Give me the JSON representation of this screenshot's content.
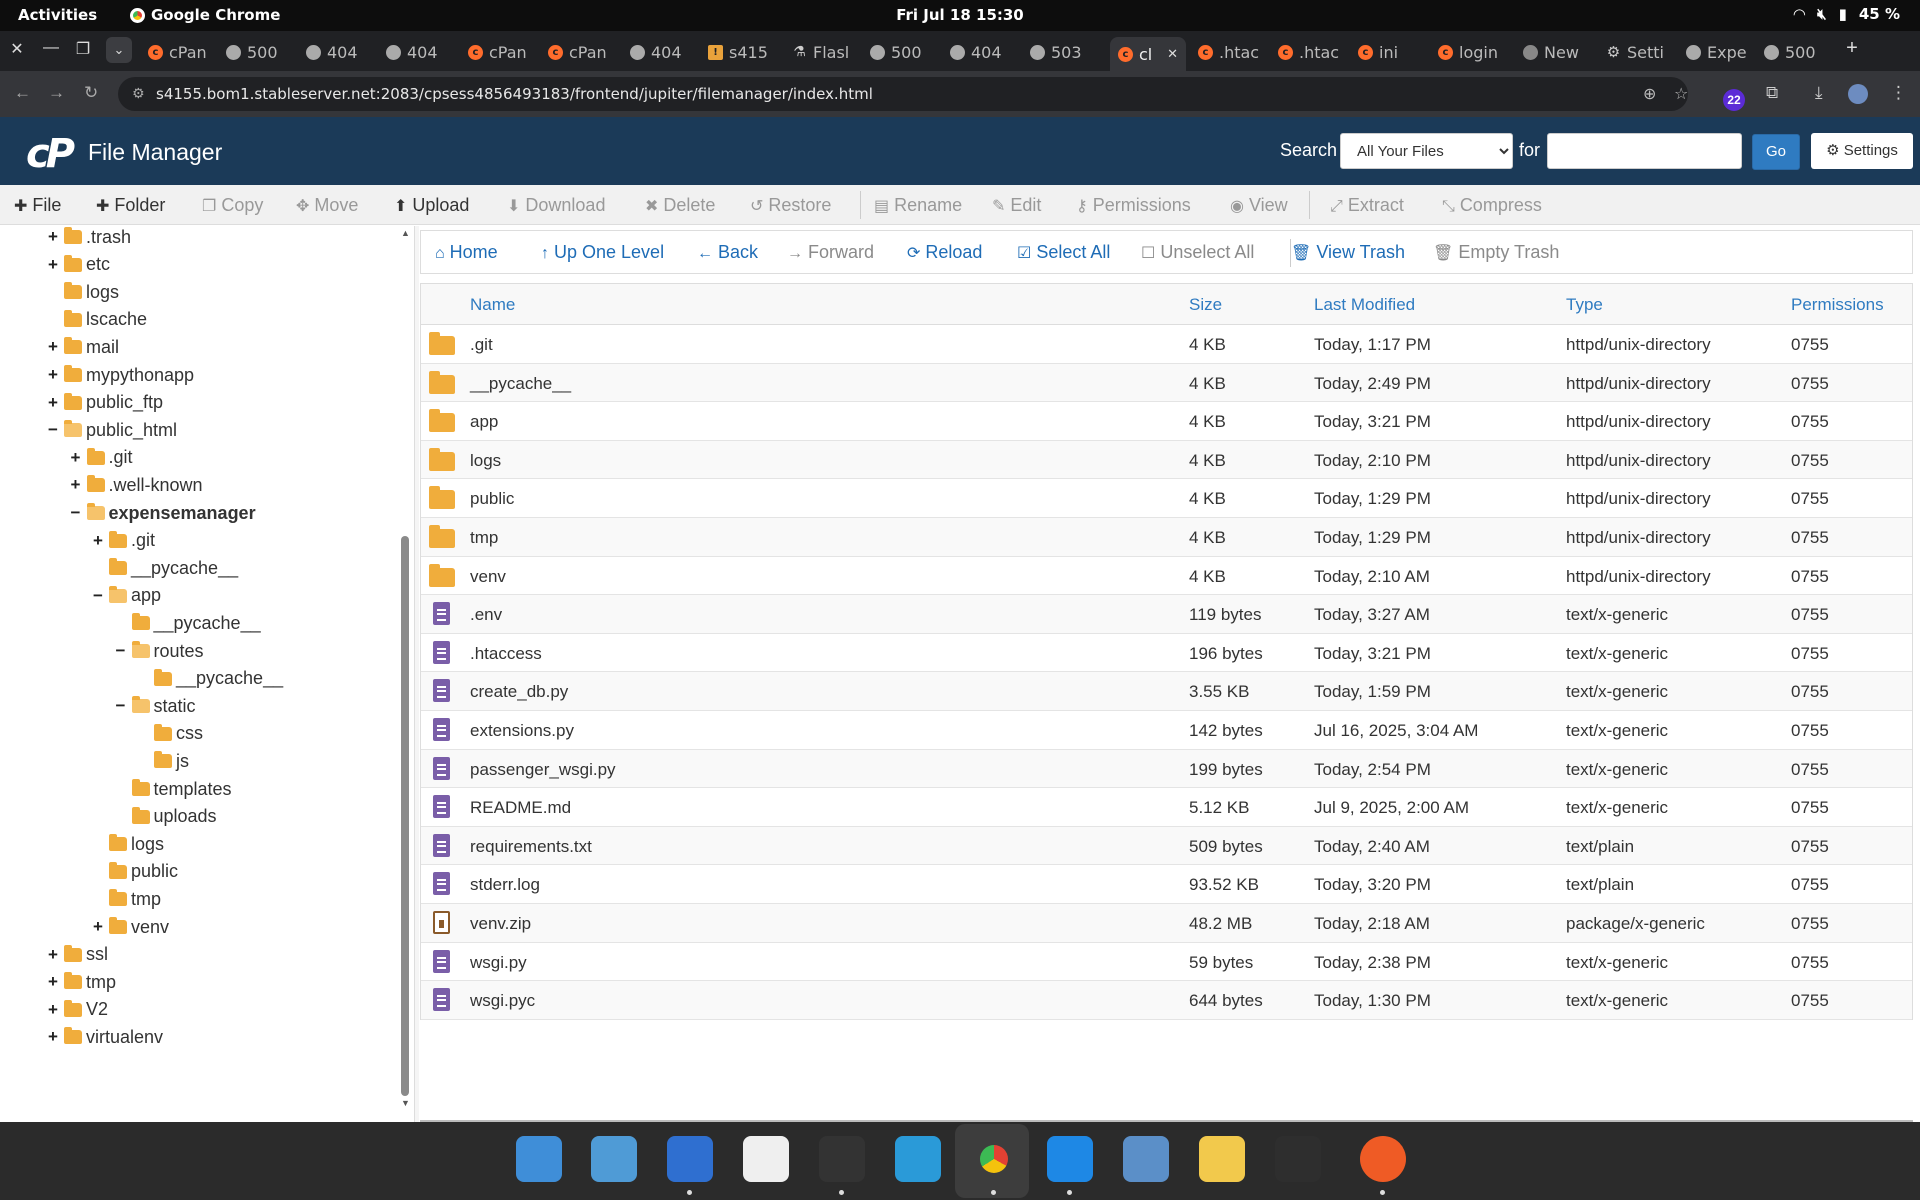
{
  "system": {
    "activities": "Activities",
    "app_name": "Google Chrome",
    "clock": "Fri Jul 18  15:30",
    "battery": "45 %"
  },
  "tabs": [
    {
      "label": "cPan",
      "icon": "cpanel-icon"
    },
    {
      "label": "500",
      "icon": "globe-icon"
    },
    {
      "label": "404",
      "icon": "globe-icon"
    },
    {
      "label": "404",
      "icon": "globe-icon"
    },
    {
      "label": "cPan",
      "icon": "cpanel-icon"
    },
    {
      "label": "cPan",
      "icon": "cpanel-icon"
    },
    {
      "label": "404",
      "icon": "globe-icon"
    },
    {
      "label": "s415",
      "icon": "warning-icon"
    },
    {
      "label": "Flasl",
      "icon": "flask-icon"
    },
    {
      "label": "500",
      "icon": "globe-icon"
    },
    {
      "label": "404",
      "icon": "globe-icon"
    },
    {
      "label": "503",
      "icon": "globe-icon"
    },
    {
      "label": "cl",
      "icon": "cpanel-icon",
      "active": true
    },
    {
      "label": ".htac",
      "icon": "cpanel-icon"
    },
    {
      "label": ".htac",
      "icon": "cpanel-icon"
    },
    {
      "label": "ini",
      "icon": "cpanel-icon"
    },
    {
      "label": "login",
      "icon": "cpanel-icon"
    },
    {
      "label": "New",
      "icon": "chrome-icon"
    },
    {
      "label": "Setti",
      "icon": "gear-icon"
    },
    {
      "label": "Expe",
      "icon": "globe-icon"
    },
    {
      "label": "500",
      "icon": "globe-icon"
    }
  ],
  "address": {
    "url": "s4155.bom1.stableserver.net:2083/cpsess4856493183/frontend/jupiter/filemanager/index.html",
    "extension_badge": "22"
  },
  "header": {
    "logo": "cP",
    "title": "File Manager",
    "search_label": "Search",
    "search_scope": "All Your Files",
    "for_label": "for",
    "search_value": "",
    "go_label": "Go",
    "settings_label": "Settings"
  },
  "toolbar": {
    "file": "File",
    "folder": "Folder",
    "copy": "Copy",
    "move": "Move",
    "upload": "Upload",
    "download": "Download",
    "delete": "Delete",
    "restore": "Restore",
    "rename": "Rename",
    "edit": "Edit",
    "permissions": "Permissions",
    "view": "View",
    "extract": "Extract",
    "compress": "Compress"
  },
  "tree": [
    {
      "label": ".trash",
      "level": 0,
      "toggle": "+"
    },
    {
      "label": "etc",
      "level": 0,
      "toggle": "+"
    },
    {
      "label": "logs",
      "level": 0,
      "toggle": ""
    },
    {
      "label": "lscache",
      "level": 0,
      "toggle": ""
    },
    {
      "label": "mail",
      "level": 0,
      "toggle": "+"
    },
    {
      "label": "mypythonapp",
      "level": 0,
      "toggle": "+"
    },
    {
      "label": "public_ftp",
      "level": 0,
      "toggle": "+"
    },
    {
      "label": "public_html",
      "level": 0,
      "toggle": "−",
      "open": true
    },
    {
      "label": ".git",
      "level": 1,
      "toggle": "+"
    },
    {
      "label": ".well-known",
      "level": 1,
      "toggle": "+"
    },
    {
      "label": "expensemanager",
      "level": 1,
      "toggle": "−",
      "open": true,
      "bold": true
    },
    {
      "label": ".git",
      "level": 2,
      "toggle": "+"
    },
    {
      "label": "__pycache__",
      "level": 2,
      "toggle": ""
    },
    {
      "label": "app",
      "level": 2,
      "toggle": "−",
      "open": true
    },
    {
      "label": "__pycache__",
      "level": 3,
      "toggle": ""
    },
    {
      "label": "routes",
      "level": 3,
      "toggle": "−",
      "open": true
    },
    {
      "label": "__pycache__",
      "level": 4,
      "toggle": ""
    },
    {
      "label": "static",
      "level": 3,
      "toggle": "−",
      "open": true
    },
    {
      "label": "css",
      "level": 4,
      "toggle": ""
    },
    {
      "label": "js",
      "level": 4,
      "toggle": ""
    },
    {
      "label": "templates",
      "level": 3,
      "toggle": ""
    },
    {
      "label": "uploads",
      "level": 3,
      "toggle": ""
    },
    {
      "label": "logs",
      "level": 2,
      "toggle": ""
    },
    {
      "label": "public",
      "level": 2,
      "toggle": ""
    },
    {
      "label": "tmp",
      "level": 2,
      "toggle": ""
    },
    {
      "label": "venv",
      "level": 2,
      "toggle": "+"
    },
    {
      "label": "ssl",
      "level": 0,
      "toggle": "+"
    },
    {
      "label": "tmp",
      "level": 0,
      "toggle": "+"
    },
    {
      "label": "V2",
      "level": 0,
      "toggle": "+"
    },
    {
      "label": "virtualenv",
      "level": 0,
      "toggle": "+"
    }
  ],
  "nav": {
    "home": "Home",
    "up": "Up One Level",
    "back": "Back",
    "forward": "Forward",
    "reload": "Reload",
    "select_all": "Select All",
    "unselect_all": "Unselect All",
    "view_trash": "View Trash",
    "empty_trash": "Empty Trash"
  },
  "table": {
    "headers": {
      "name": "Name",
      "size": "Size",
      "modified": "Last Modified",
      "type": "Type",
      "perms": "Permissions"
    },
    "rows": [
      {
        "icon": "folder",
        "name": ".git",
        "size": "4 KB",
        "modified": "Today, 1:17 PM",
        "type": "httpd/unix-directory",
        "perms": "0755"
      },
      {
        "icon": "folder",
        "name": "__pycache__",
        "size": "4 KB",
        "modified": "Today, 2:49 PM",
        "type": "httpd/unix-directory",
        "perms": "0755"
      },
      {
        "icon": "folder",
        "name": "app",
        "size": "4 KB",
        "modified": "Today, 3:21 PM",
        "type": "httpd/unix-directory",
        "perms": "0755"
      },
      {
        "icon": "folder",
        "name": "logs",
        "size": "4 KB",
        "modified": "Today, 2:10 PM",
        "type": "httpd/unix-directory",
        "perms": "0755"
      },
      {
        "icon": "folder",
        "name": "public",
        "size": "4 KB",
        "modified": "Today, 1:29 PM",
        "type": "httpd/unix-directory",
        "perms": "0755"
      },
      {
        "icon": "folder",
        "name": "tmp",
        "size": "4 KB",
        "modified": "Today, 1:29 PM",
        "type": "httpd/unix-directory",
        "perms": "0755"
      },
      {
        "icon": "folder",
        "name": "venv",
        "size": "4 KB",
        "modified": "Today, 2:10 AM",
        "type": "httpd/unix-directory",
        "perms": "0755"
      },
      {
        "icon": "file",
        "name": ".env",
        "size": "119 bytes",
        "modified": "Today, 3:27 AM",
        "type": "text/x-generic",
        "perms": "0755"
      },
      {
        "icon": "file",
        "name": ".htaccess",
        "size": "196 bytes",
        "modified": "Today, 3:21 PM",
        "type": "text/x-generic",
        "perms": "0755"
      },
      {
        "icon": "file",
        "name": "create_db.py",
        "size": "3.55 KB",
        "modified": "Today, 1:59 PM",
        "type": "text/x-generic",
        "perms": "0755"
      },
      {
        "icon": "file",
        "name": "extensions.py",
        "size": "142 bytes",
        "modified": "Jul 16, 2025, 3:04 AM",
        "type": "text/x-generic",
        "perms": "0755"
      },
      {
        "icon": "file",
        "name": "passenger_wsgi.py",
        "size": "199 bytes",
        "modified": "Today, 2:54 PM",
        "type": "text/x-generic",
        "perms": "0755"
      },
      {
        "icon": "file",
        "name": "README.md",
        "size": "5.12 KB",
        "modified": "Jul 9, 2025, 2:00 AM",
        "type": "text/x-generic",
        "perms": "0755"
      },
      {
        "icon": "file",
        "name": "requirements.txt",
        "size": "509 bytes",
        "modified": "Today, 2:40 AM",
        "type": "text/plain",
        "perms": "0755"
      },
      {
        "icon": "file",
        "name": "stderr.log",
        "size": "93.52 KB",
        "modified": "Today, 3:20 PM",
        "type": "text/plain",
        "perms": "0755"
      },
      {
        "icon": "zip",
        "name": "venv.zip",
        "size": "48.2 MB",
        "modified": "Today, 2:18 AM",
        "type": "package/x-generic",
        "perms": "0755"
      },
      {
        "icon": "file",
        "name": "wsgi.py",
        "size": "59 bytes",
        "modified": "Today, 2:38 PM",
        "type": "text/x-generic",
        "perms": "0755"
      },
      {
        "icon": "file",
        "name": "wsgi.pyc",
        "size": "644 bytes",
        "modified": "Today, 1:30 PM",
        "type": "text/x-generic",
        "perms": "0755"
      }
    ]
  },
  "dock": [
    {
      "icon": "search-app-icon",
      "color": "#3f8ed8",
      "running": false
    },
    {
      "icon": "files-icon",
      "color": "#4f9bd6",
      "running": false
    },
    {
      "icon": "documents-icon",
      "color": "#2f6fd0",
      "running": true
    },
    {
      "icon": "gimp-icon",
      "color": "#efefef",
      "running": false
    },
    {
      "icon": "terminal-icon",
      "color": "#333333",
      "running": true
    },
    {
      "icon": "app-grid-icon",
      "color": "#2a9ad8",
      "running": false
    },
    {
      "icon": "chrome-icon",
      "color": "#e34133",
      "running": true
    },
    {
      "icon": "vscode-icon",
      "color": "#1e88e5",
      "running": true
    },
    {
      "icon": "postgres-icon",
      "color": "#5b8fc8",
      "running": false
    },
    {
      "icon": "text-editor-icon",
      "color": "#f2c94c",
      "running": false
    },
    {
      "icon": "system-monitor-icon",
      "color": "#2e2e2e",
      "running": false
    },
    {
      "icon": "postman-icon",
      "color": "#ef5b25",
      "running": true
    }
  ]
}
